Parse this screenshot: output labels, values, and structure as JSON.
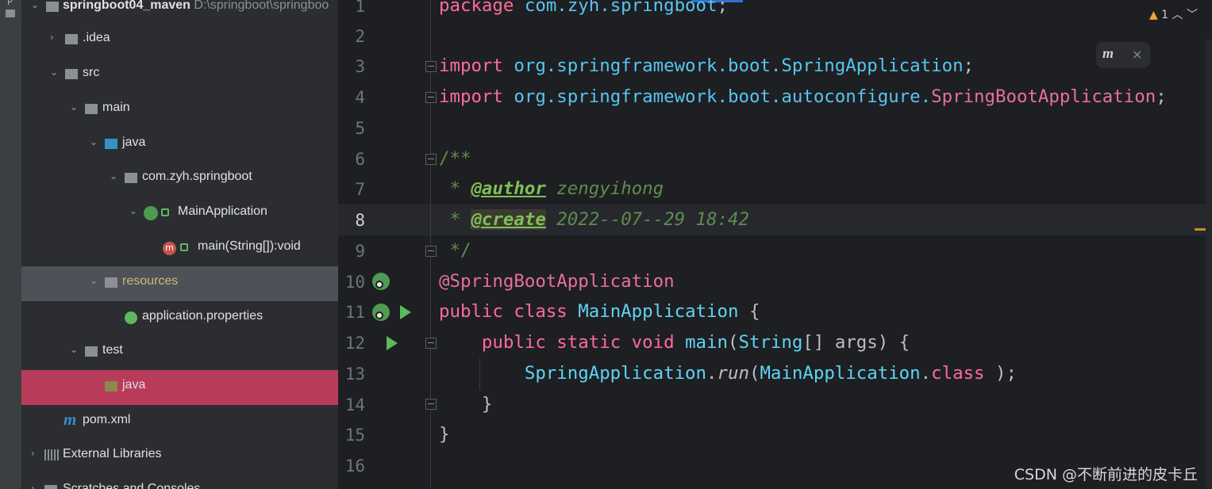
{
  "project_tree": {
    "root": {
      "name": "springboot04_maven",
      "path": "D:\\springboot\\springboo"
    },
    "items": [
      {
        "label": ".idea"
      },
      {
        "label": "src"
      },
      {
        "label": "main"
      },
      {
        "label": "java"
      },
      {
        "label": "com.zyh.springboot"
      },
      {
        "label": "MainApplication"
      },
      {
        "label": "main(String[]):void"
      },
      {
        "label": "resources"
      },
      {
        "label": "application.properties"
      },
      {
        "label": "test"
      },
      {
        "label": "java"
      },
      {
        "label": "pom.xml"
      },
      {
        "label": "External Libraries"
      },
      {
        "label": "Scratches and Consoles"
      }
    ]
  },
  "editor": {
    "line_numbers": [
      "1",
      "2",
      "3",
      "4",
      "5",
      "6",
      "7",
      "8",
      "9",
      "10",
      "11",
      "12",
      "13",
      "14",
      "15",
      "16"
    ],
    "current_line": "8",
    "lines": {
      "l1": {
        "kw": "package",
        "pkg": " com.zyh.springboot",
        "end": ";"
      },
      "l3": {
        "kw": "import",
        "pkg": " org.springframework.boot.SpringApplication",
        "end": ";"
      },
      "l4": {
        "kw": "import",
        "pkg": " org.springframework.boot.autoconfigure.",
        "cls": "SpringBootApplication",
        "end": ";"
      },
      "l6": "/**",
      "l7": {
        "star": " * ",
        "tag": "@author",
        "val": " zengyihong"
      },
      "l8": {
        "star": " * ",
        "tag": "@create",
        "val": " 2022--07--29 18:42"
      },
      "l9": " */",
      "l10": "@SpringBootApplication",
      "l11": {
        "kw1": "public",
        "kw2": "class",
        "name": "MainApplication",
        "end": " {"
      },
      "l12": {
        "kw1": "public",
        "kw2": "static",
        "kw3": "void",
        "name": "main",
        "p1": "(",
        "type": "String",
        "p2": "[] args) {"
      },
      "l13": {
        "cls": "SpringApplication",
        "dot": ".",
        "meth": "run",
        "p1": "(",
        "cls2": "MainApplication",
        "dot2": ".",
        "kw": "class",
        "end": " );"
      },
      "l14": "}",
      "l15": "}"
    }
  },
  "inspections": {
    "warning_count": "1"
  },
  "maven_popup": {
    "icon": "m",
    "close": "×"
  },
  "watermark": "CSDN @不断前进的皮卡丘",
  "colors": {
    "selected_row": "#b93b5a",
    "selected_grey": "#4e5157",
    "editor_bg": "#1e1f22"
  }
}
